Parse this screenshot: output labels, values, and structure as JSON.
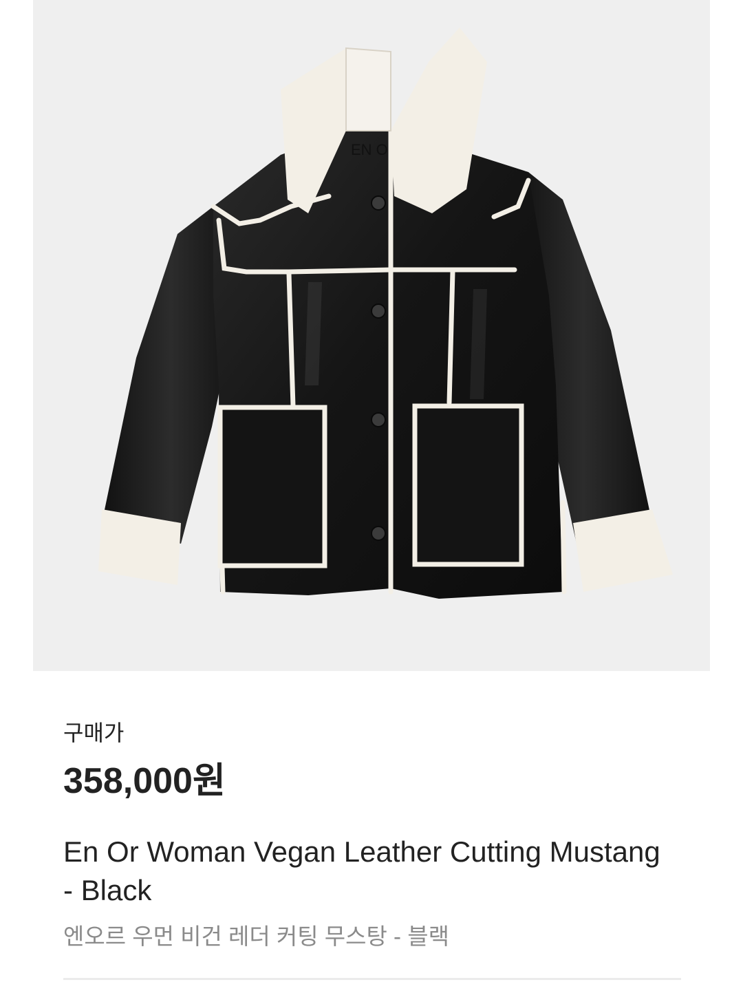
{
  "product": {
    "image_alt": "jacket-product-photo",
    "label_text": "EN O",
    "price_label": "구매가",
    "price": "358,000원",
    "name_en": "En Or Woman Vegan Leather Cutting Mustang - Black",
    "name_ko": "엔오르 우먼 비건 레더 커팅 무스탕 - 블랙"
  },
  "colors": {
    "image_background": "#efefef",
    "leather": "#1a1a1a",
    "shearling": "#f3efe6",
    "price_text": "#222222",
    "subtitle_text": "#8a8a8a",
    "divider": "#ebebeb"
  }
}
